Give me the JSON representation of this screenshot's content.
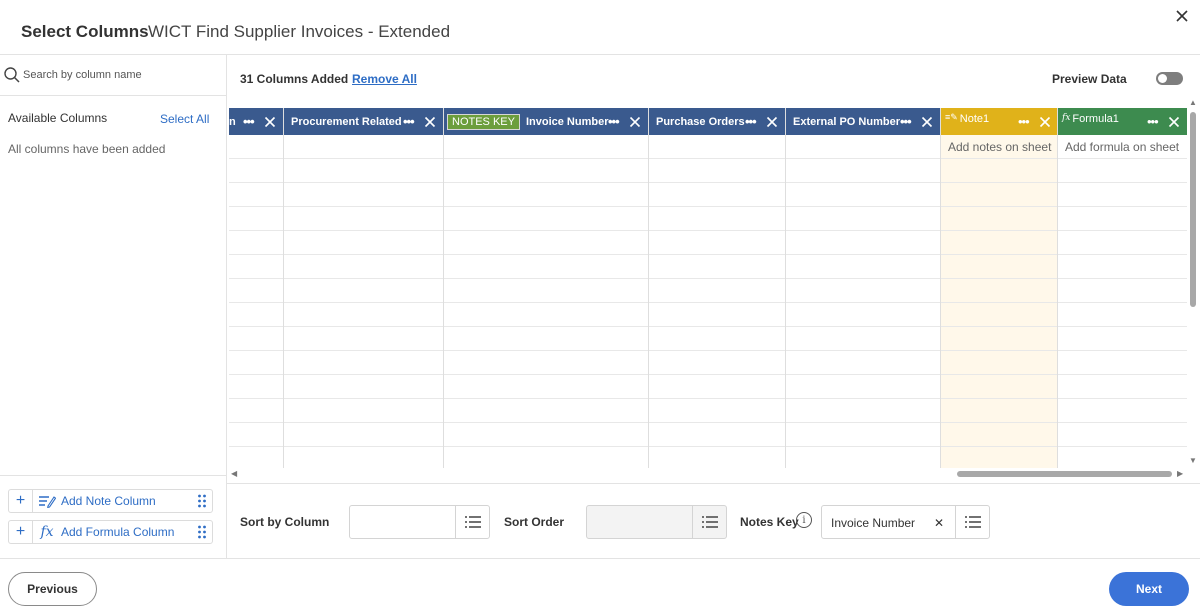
{
  "header": {
    "title": "Select Columns",
    "subtitle": "WICT Find Supplier Invoices - Extended"
  },
  "left": {
    "search_placeholder": "Search by column name",
    "available_title": "Available Columns",
    "select_all": "Select All",
    "empty_message": "All columns have been added",
    "add_note_label": "Add Note Column",
    "add_formula_label": "Add Formula Column"
  },
  "toolbar": {
    "count": "31 Columns Added",
    "remove_all": "Remove All",
    "preview_label": "Preview Data",
    "preview_on": false
  },
  "grid": {
    "columns": [
      {
        "name": "n",
        "type": "standard"
      },
      {
        "name": "Procurement Related",
        "type": "standard"
      },
      {
        "name": "Invoice Number",
        "type": "standard",
        "badge": "NOTES KEY"
      },
      {
        "name": "Purchase Orders",
        "type": "standard"
      },
      {
        "name": "External PO Number",
        "type": "standard"
      },
      {
        "name": "Note1",
        "type": "note",
        "placeholder": "Add notes on sheet"
      },
      {
        "name": "Formula1",
        "type": "formula",
        "placeholder": "Add formula on sheet"
      }
    ]
  },
  "controls": {
    "sort_by_label": "Sort by Column",
    "sort_by_value": "",
    "sort_order_label": "Sort Order",
    "sort_order_value": "",
    "notes_key_label": "Notes Key",
    "notes_key_value": "Invoice Number"
  },
  "footer": {
    "previous": "Previous",
    "next": "Next"
  },
  "colors": {
    "header_blue": "#3a5a8e",
    "note_yellow": "#e0b21a",
    "formula_green": "#3d8b4f",
    "primary": "#3b73d8",
    "link": "#2e6dc5"
  }
}
